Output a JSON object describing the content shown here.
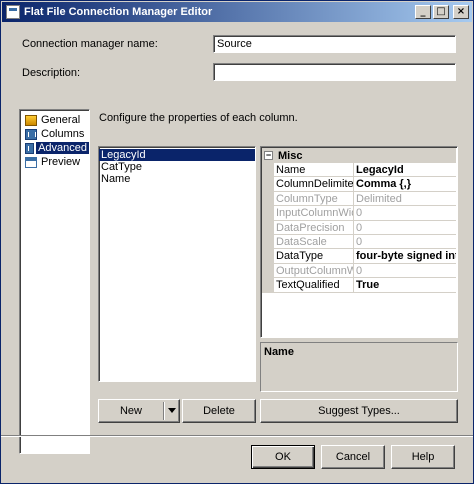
{
  "window": {
    "title": "Flat File Connection Manager Editor",
    "controls": {
      "minimize": "_",
      "maximize": "□",
      "close": "×"
    }
  },
  "form": {
    "connection_name_label": "Connection manager name:",
    "connection_name_value": "Source",
    "description_label": "Description:",
    "description_value": ""
  },
  "nav": {
    "items": [
      {
        "label": "General",
        "icon": "general-icon"
      },
      {
        "label": "Columns",
        "icon": "columns-icon"
      },
      {
        "label": "Advanced",
        "icon": "advanced-icon",
        "selected": true
      },
      {
        "label": "Preview",
        "icon": "preview-icon"
      }
    ]
  },
  "main": {
    "instruction": "Configure the properties of each column.",
    "columns": [
      "LegacyId",
      "CatType",
      "Name"
    ],
    "selected_column": "LegacyId"
  },
  "property_grid": {
    "category": "Misc",
    "rows": [
      {
        "name": "Name",
        "value": "LegacyId",
        "bold": true,
        "disabled": false
      },
      {
        "name": "ColumnDelimiter",
        "value": "Comma {,}",
        "bold": true,
        "disabled": false
      },
      {
        "name": "ColumnType",
        "value": "Delimited",
        "bold": false,
        "disabled": true
      },
      {
        "name": "InputColumnWidth",
        "value": "0",
        "bold": false,
        "disabled": true
      },
      {
        "name": "DataPrecision",
        "value": "0",
        "bold": false,
        "disabled": true
      },
      {
        "name": "DataScale",
        "value": "0",
        "bold": false,
        "disabled": true
      },
      {
        "name": "DataType",
        "value": "four-byte signed inte",
        "bold": true,
        "disabled": false
      },
      {
        "name": "OutputColumnWid",
        "value": "0",
        "bold": false,
        "disabled": true
      },
      {
        "name": "TextQualified",
        "value": "True",
        "bold": true,
        "disabled": false
      }
    ],
    "description_title": "Name"
  },
  "buttons": {
    "new": "New",
    "delete": "Delete",
    "suggest": "Suggest Types...",
    "ok": "OK",
    "cancel": "Cancel",
    "help": "Help"
  }
}
